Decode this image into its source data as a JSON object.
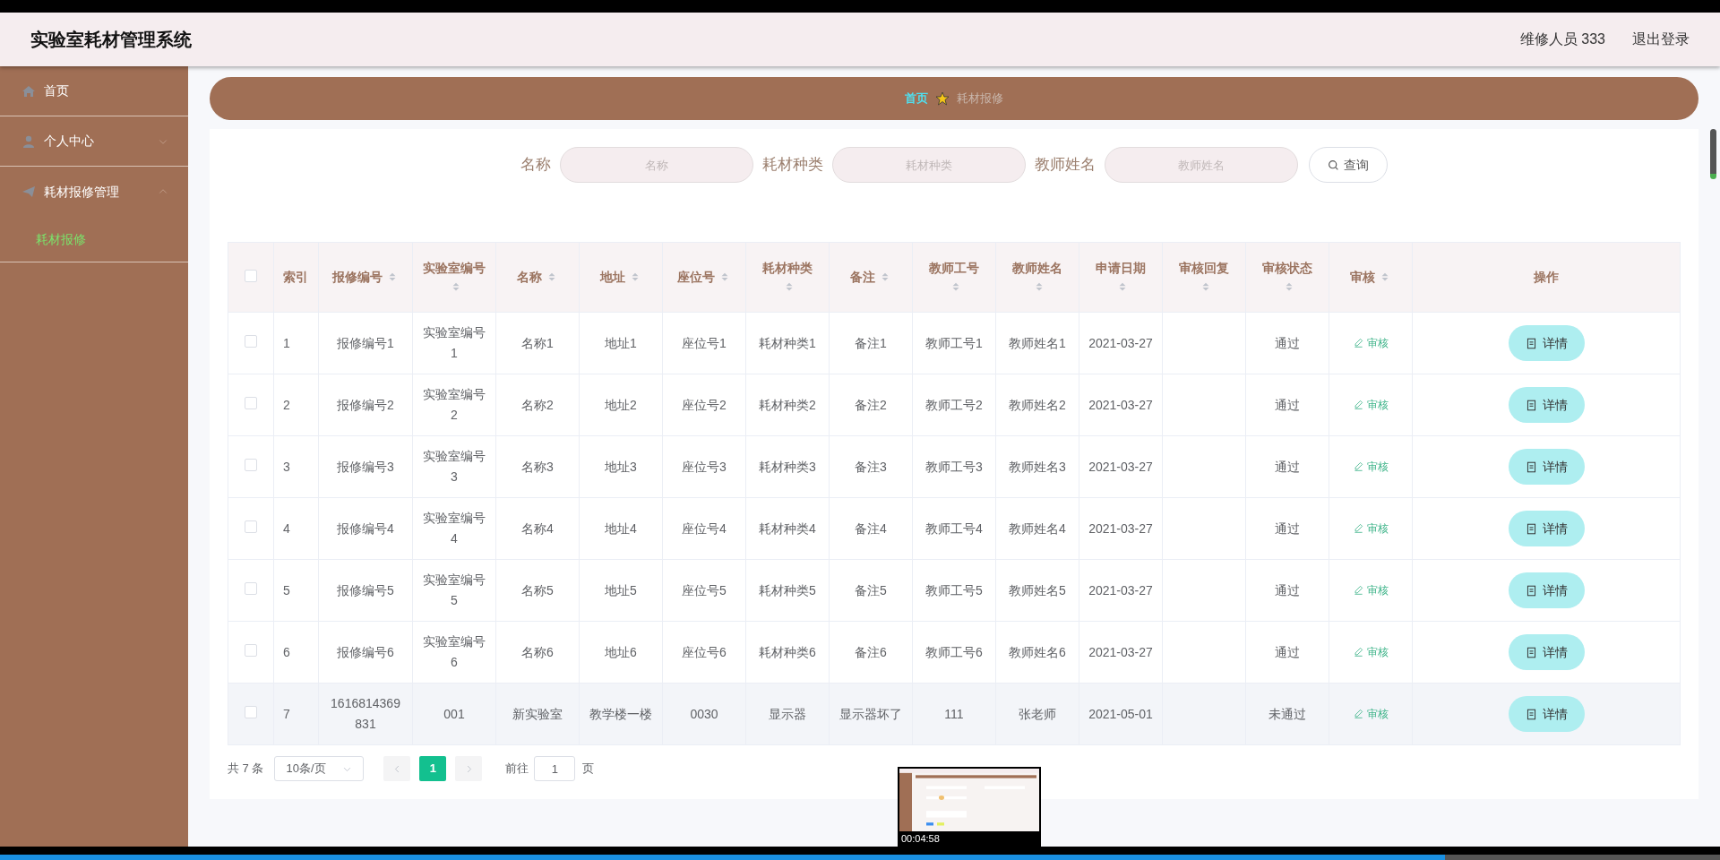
{
  "header": {
    "title": "实验室耗材管理系统",
    "user": "维修人员 333",
    "logout": "退出登录"
  },
  "sidebar": {
    "items": [
      {
        "label": "首页",
        "has_arrow": false
      },
      {
        "label": "个人中心",
        "expanded": false,
        "has_arrow": true
      },
      {
        "label": "耗材报修管理",
        "expanded": true,
        "has_arrow": true,
        "children": [
          {
            "label": "耗材报修",
            "selected": true
          }
        ]
      }
    ]
  },
  "breadcrumb": {
    "items": [
      {
        "label": "首页",
        "current": false
      },
      {
        "label": "耗材报修",
        "current": true
      }
    ]
  },
  "search": {
    "fields": [
      {
        "label": "名称",
        "placeholder": "名称"
      },
      {
        "label": "耗材种类",
        "placeholder": "耗材种类"
      },
      {
        "label": "教师姓名",
        "placeholder": "教师姓名"
      }
    ],
    "button": "查询"
  },
  "table": {
    "header_checked": false,
    "columns": [
      {
        "label": "索引",
        "sortable": false
      },
      {
        "label": "报修编号",
        "sortable": true
      },
      {
        "label": "实验室编号",
        "sortable": true
      },
      {
        "label": "名称",
        "sortable": true
      },
      {
        "label": "地址",
        "sortable": true
      },
      {
        "label": "座位号",
        "sortable": true
      },
      {
        "label": "耗材种类",
        "sortable": true
      },
      {
        "label": "备注",
        "sortable": true
      },
      {
        "label": "教师工号",
        "sortable": true
      },
      {
        "label": "教师姓名",
        "sortable": true
      },
      {
        "label": "申请日期",
        "sortable": true
      },
      {
        "label": "审核回复",
        "sortable": true
      },
      {
        "label": "审核状态",
        "sortable": true
      },
      {
        "label": "审核",
        "sortable": true
      },
      {
        "label": "操作",
        "sortable": false
      }
    ],
    "rows": [
      {
        "checked": false,
        "highlighted": false,
        "cells": [
          "1",
          "报修编号1",
          "实验室编号1",
          "名称1",
          "地址1",
          "座位号1",
          "耗材种类1",
          "备注1",
          "教师工号1",
          "教师姓名1",
          "2021-03-27",
          "",
          "通过"
        ],
        "review": "审核",
        "action": "详情"
      },
      {
        "checked": false,
        "highlighted": false,
        "cells": [
          "2",
          "报修编号2",
          "实验室编号2",
          "名称2",
          "地址2",
          "座位号2",
          "耗材种类2",
          "备注2",
          "教师工号2",
          "教师姓名2",
          "2021-03-27",
          "",
          "通过"
        ],
        "review": "审核",
        "action": "详情"
      },
      {
        "checked": false,
        "highlighted": false,
        "cells": [
          "3",
          "报修编号3",
          "实验室编号3",
          "名称3",
          "地址3",
          "座位号3",
          "耗材种类3",
          "备注3",
          "教师工号3",
          "教师姓名3",
          "2021-03-27",
          "",
          "通过"
        ],
        "review": "审核",
        "action": "详情"
      },
      {
        "checked": false,
        "highlighted": false,
        "cells": [
          "4",
          "报修编号4",
          "实验室编号4",
          "名称4",
          "地址4",
          "座位号4",
          "耗材种类4",
          "备注4",
          "教师工号4",
          "教师姓名4",
          "2021-03-27",
          "",
          "通过"
        ],
        "review": "审核",
        "action": "详情"
      },
      {
        "checked": false,
        "highlighted": false,
        "cells": [
          "5",
          "报修编号5",
          "实验室编号5",
          "名称5",
          "地址5",
          "座位号5",
          "耗材种类5",
          "备注5",
          "教师工号5",
          "教师姓名5",
          "2021-03-27",
          "",
          "通过"
        ],
        "review": "审核",
        "action": "详情"
      },
      {
        "checked": false,
        "highlighted": false,
        "cells": [
          "6",
          "报修编号6",
          "实验室编号6",
          "名称6",
          "地址6",
          "座位号6",
          "耗材种类6",
          "备注6",
          "教师工号6",
          "教师姓名6",
          "2021-03-27",
          "",
          "通过"
        ],
        "review": "审核",
        "action": "详情"
      },
      {
        "checked": false,
        "highlighted": true,
        "cells": [
          "7",
          "1616814369831",
          "001",
          "新实验室",
          "教学楼一楼",
          "0030",
          "显示器",
          "显示器坏了",
          "111",
          "张老师",
          "2021-05-01",
          "",
          "未通过"
        ],
        "review": "审核",
        "action": "详情"
      }
    ]
  },
  "pagination": {
    "total": "共 7 条",
    "page_size": "10条/页",
    "pages": [
      {
        "label": "1",
        "selected": true
      }
    ],
    "goto_label": "前往",
    "goto_value": "1",
    "goto_suffix": "页"
  },
  "video_player": {
    "preview_time": "00:04:58",
    "progress": {
      "level": 0.84
    }
  }
}
